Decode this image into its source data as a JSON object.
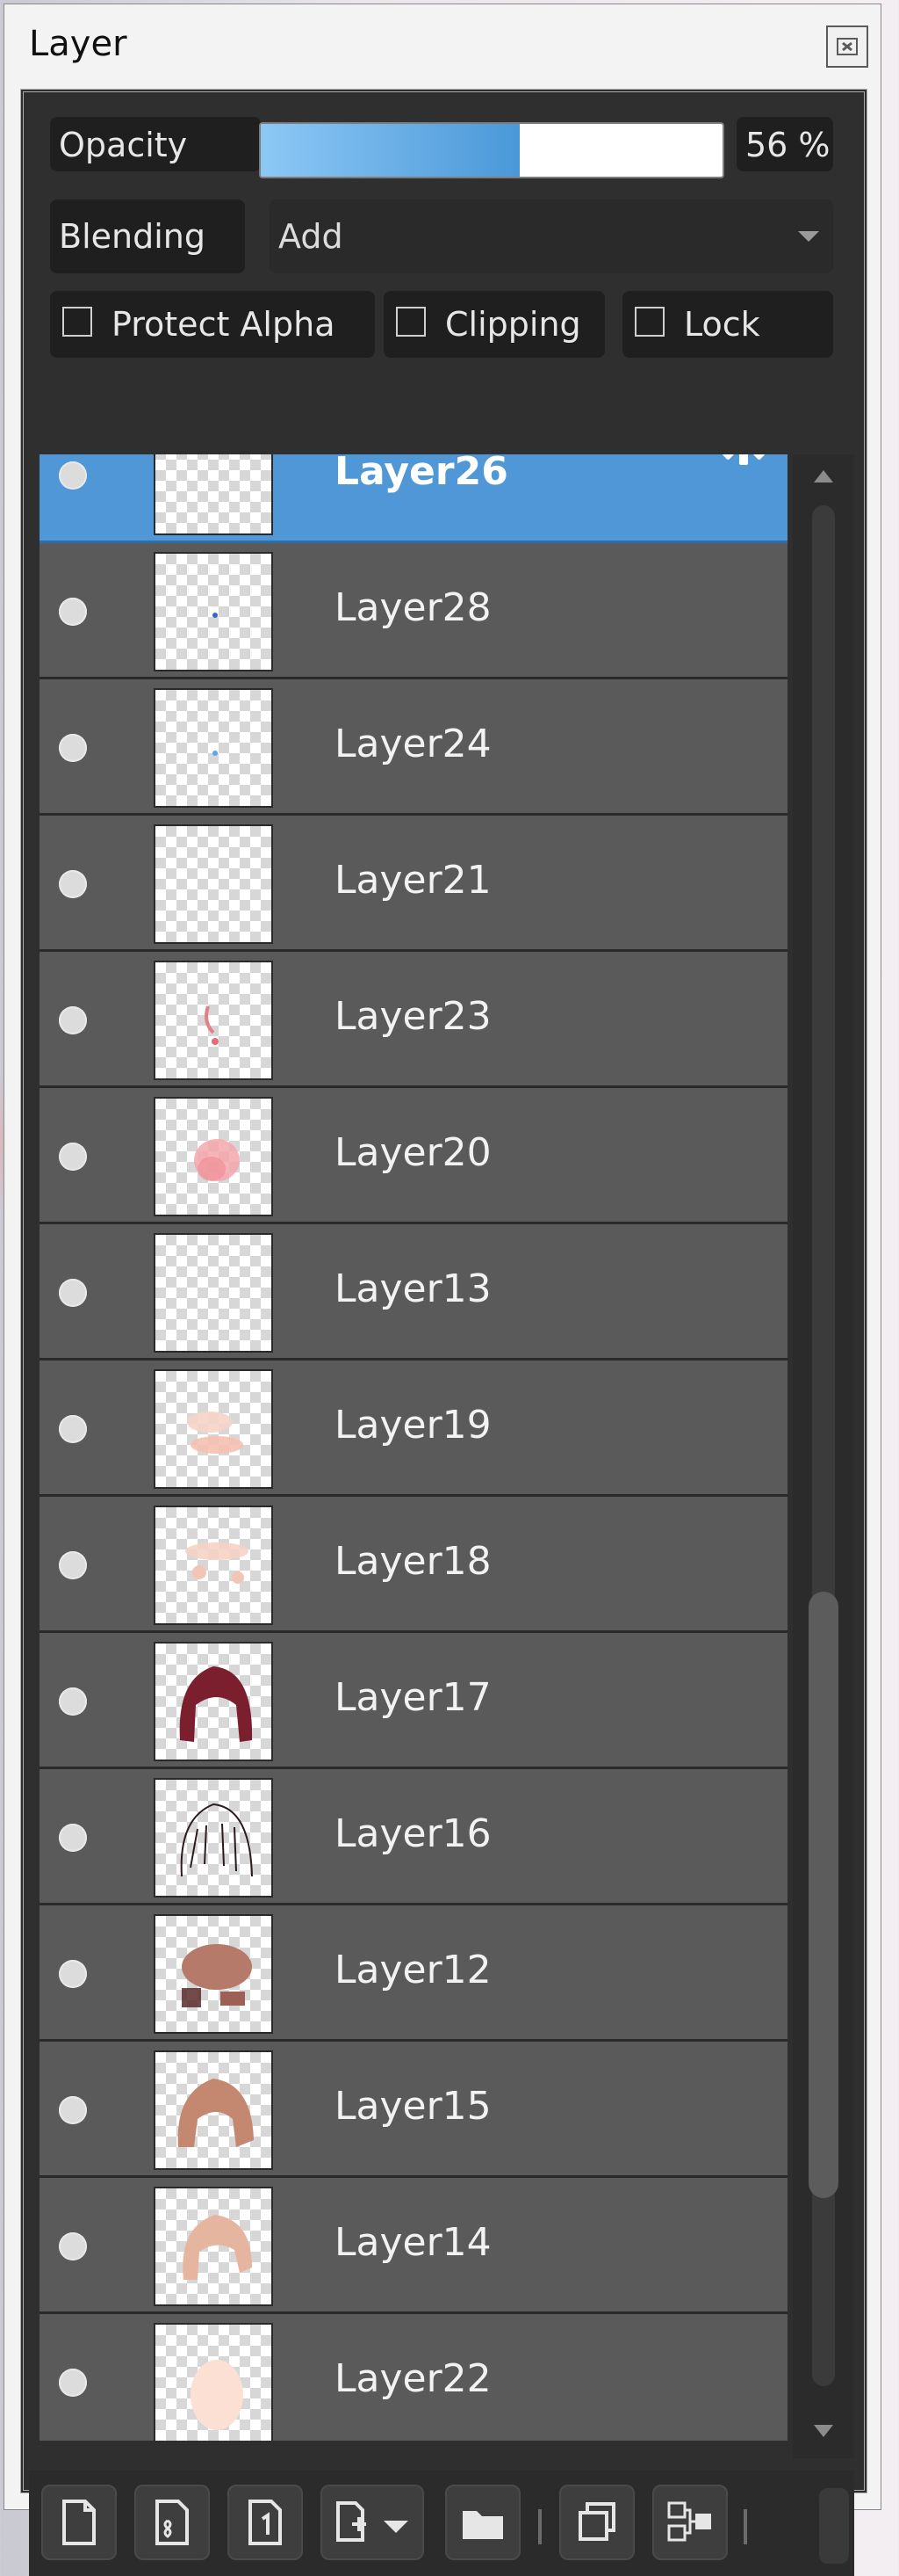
{
  "window": {
    "title": "Layer"
  },
  "controls": {
    "opacity_label": "Opacity",
    "opacity_value": "56 %",
    "opacity_percent": 56,
    "blending_label": "Blending",
    "blending_value": "Add",
    "checkboxes": [
      {
        "label": "Protect Alpha",
        "checked": false
      },
      {
        "label": "Clipping",
        "checked": false
      },
      {
        "label": "Lock",
        "checked": false
      }
    ]
  },
  "layers": [
    {
      "name": "Layer26",
      "selected": true,
      "thumbnail": "blank"
    },
    {
      "name": "Layer28",
      "selected": false,
      "thumbnail": "dot-blue"
    },
    {
      "name": "Layer24",
      "selected": false,
      "thumbnail": "dot-lightblue"
    },
    {
      "name": "Layer21",
      "selected": false,
      "thumbnail": "blank"
    },
    {
      "name": "Layer23",
      "selected": false,
      "thumbnail": "stroke-red"
    },
    {
      "name": "Layer20",
      "selected": false,
      "thumbnail": "blush-pink"
    },
    {
      "name": "Layer13",
      "selected": false,
      "thumbnail": "blank"
    },
    {
      "name": "Layer19",
      "selected": false,
      "thumbnail": "faint-peach"
    },
    {
      "name": "Layer18",
      "selected": false,
      "thumbnail": "faint-peach-2"
    },
    {
      "name": "Layer17",
      "selected": false,
      "thumbnail": "hair-maroon"
    },
    {
      "name": "Layer16",
      "selected": false,
      "thumbnail": "lineart"
    },
    {
      "name": "Layer12",
      "selected": false,
      "thumbnail": "hair-shade"
    },
    {
      "name": "Layer15",
      "selected": false,
      "thumbnail": "hair-brown"
    },
    {
      "name": "Layer14",
      "selected": false,
      "thumbnail": "hair-peach"
    },
    {
      "name": "Layer22",
      "selected": false,
      "thumbnail": "skin"
    }
  ],
  "icons": {
    "close": "close-icon",
    "settings": "gear-icon",
    "dropdown": "chevron-down-icon",
    "toolbar": [
      "new-layer-icon",
      "new-8bit-layer-icon",
      "new-1bit-layer-icon",
      "add-layer-menu-icon",
      "folder-icon",
      "duplicate-layer-icon",
      "merge-layer-icon"
    ]
  },
  "colors": {
    "selected_row": "#4f97d6",
    "opacity_fill_start": "#8dc8f6",
    "opacity_fill_end": "#4a98d8"
  }
}
